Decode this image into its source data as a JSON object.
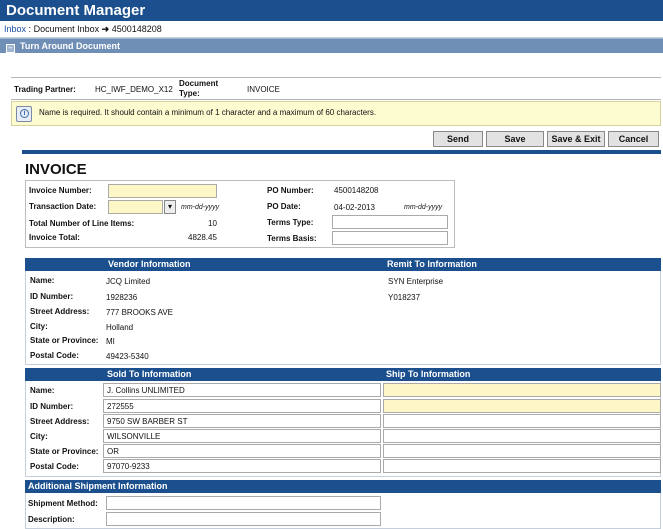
{
  "app": {
    "title": "Document Manager"
  },
  "breadcrumb": {
    "inbox": "Inbox",
    "sep1": ":",
    "doc_inbox": "Document Inbox",
    "arrow": "➜",
    "number": "4500148208"
  },
  "section": {
    "title": "Turn Around Document",
    "toggle": "–"
  },
  "partner": {
    "label": "Trading Partner:",
    "value": "HC_IWF_DEMO_X12",
    "doctype_label_1": "Document",
    "doctype_label_2": "Type:",
    "doctype_value": "INVOICE"
  },
  "message": {
    "text": "Name is required. It should contain a minimum of 1 character and a maximum of 60 characters.",
    "icon": "i"
  },
  "buttons": {
    "send": "Send",
    "save": "Save",
    "save_exit": "Save & Exit",
    "cancel": "Cancel"
  },
  "invoice": {
    "title": "INVOICE",
    "invoice_number_label": "Invoice Number:",
    "invoice_number_value": "",
    "transaction_date_label": "Transaction Date:",
    "transaction_date_value": "",
    "date_format": "mm-dd-yyyy",
    "calendar_icon": "▾",
    "total_lines_label": "Total Number of Line Items:",
    "total_lines_value": "10",
    "invoice_total_label": "Invoice Total:",
    "invoice_total_value": "4828.45",
    "po_number_label": "PO Number:",
    "po_number_value": "4500148208",
    "po_date_label": "PO Date:",
    "po_date_value": "04-02-2013",
    "terms_type_label": "Terms Type:",
    "terms_basis_label": "Terms Basis:"
  },
  "vendor": {
    "header": "Vendor Information",
    "remit_header": "Remit To Information",
    "labels": [
      "Name:",
      "ID Number:",
      "Street Address:",
      "City:",
      "State or Province:",
      "Postal Code:"
    ],
    "values": [
      "JCQ Limited",
      "1928236",
      "777 BROOKS AVE",
      "Holland",
      "MI",
      "49423-5340"
    ],
    "remit_values": [
      "SYN Enterprise",
      "Y018237"
    ]
  },
  "soldto": {
    "header": "Sold To Information",
    "shipto_header": "Ship To Information",
    "labels": [
      "Name:",
      "ID Number:",
      "Street Address:",
      "City:",
      "State or Province:",
      "Postal Code:"
    ],
    "values": [
      "J. Collins UNLIMITED",
      "272555",
      "9750 SW BARBER ST",
      "WILSONVILLE",
      "OR",
      "97070-9233"
    ]
  },
  "shipment": {
    "header": "Additional Shipment Information",
    "method_label": "Shipment Method:",
    "description_label": "Description:"
  }
}
